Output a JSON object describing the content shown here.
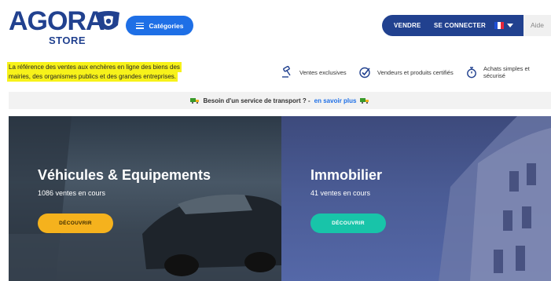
{
  "logo": {
    "word": "AGORA",
    "sub": "STORE"
  },
  "header": {
    "categories_label": "Catégories",
    "sell_label": "VENDRE",
    "login_label": "SE CONNECTER",
    "help_label": "Aide"
  },
  "tagline": {
    "line1": "La référence des ventes aux enchères en ligne des biens des",
    "line2": "mairies, des organismes publics et des grandes entreprises."
  },
  "features": [
    {
      "label": "Ventes exclusives",
      "icon": "auction-hammer-icon"
    },
    {
      "label": "Vendeurs et produits certifiés",
      "icon": "check-circle-icon"
    },
    {
      "label": "Achats simples et sécurisé",
      "icon": "stopwatch-icon"
    }
  ],
  "banner": {
    "text": "Besoin d'un service de transport ? -",
    "link": "en savoir plus"
  },
  "panels": [
    {
      "title": "Véhicules & Equipements",
      "count": "1086 ventes en cours",
      "cta": "DÉCOUVRIR"
    },
    {
      "title": "Immobilier",
      "count": "41 ventes en cours",
      "cta": "DÉCOUVRIR"
    }
  ],
  "colors": {
    "brand": "#21418f",
    "accent": "#1e6fe6",
    "yellow_cta": "#f5b21d",
    "teal_cta": "#18c4a9"
  }
}
